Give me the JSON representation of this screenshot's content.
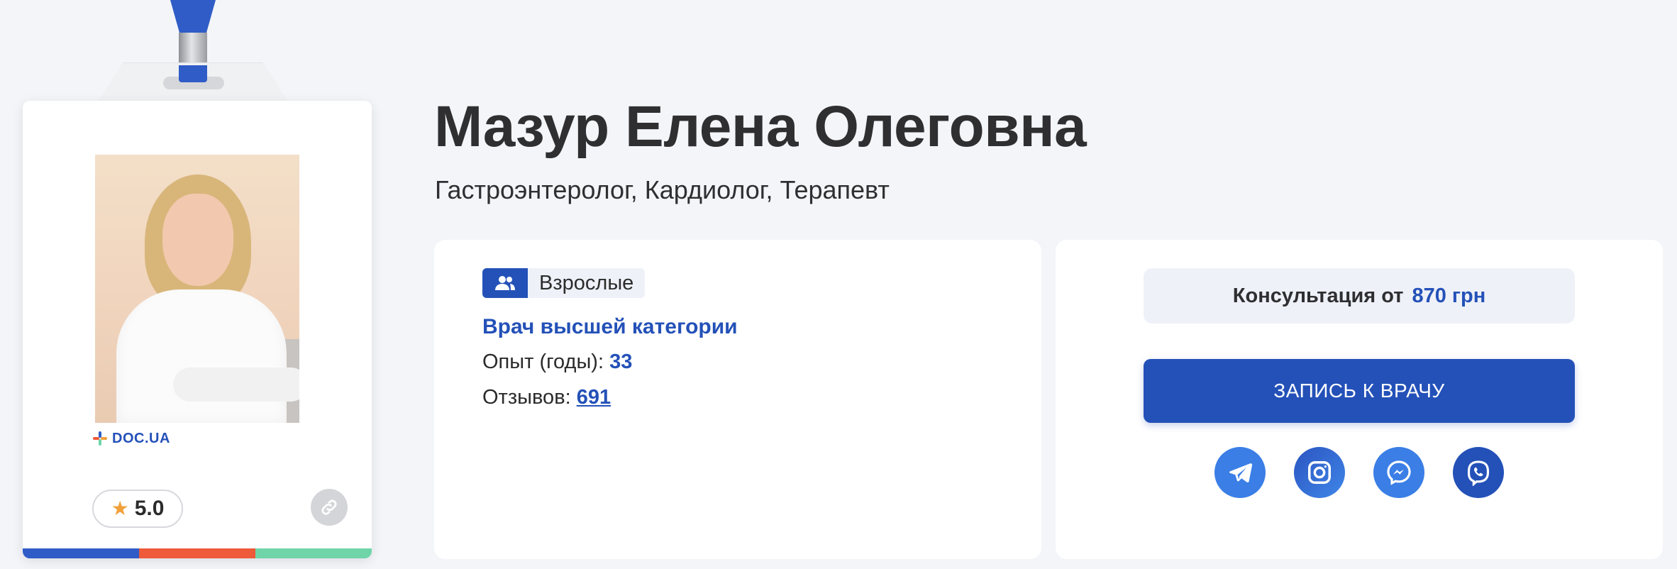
{
  "doctor": {
    "name": "Мазур Елена Олеговна",
    "specialties": "Гастроэнтеролог, Кардиолог, Терапевт"
  },
  "badge": {
    "brand": "DOC.UA",
    "rating": "5.0",
    "stripe_colors": [
      "#2f5cc7",
      "#ee5a3a",
      "#6fd5a9"
    ]
  },
  "info": {
    "age_group": "Взрослые",
    "category": "Врач высшей категории",
    "experience_label": "Опыт (годы):",
    "experience_value": "33",
    "reviews_label": "Отзывов:",
    "reviews_value": "691"
  },
  "booking": {
    "price_label": "Консультация от",
    "price_value": "870 грн",
    "book_button": "ЗАПИСЬ К ВРАЧУ",
    "socials": [
      "telegram-icon",
      "instagram-icon",
      "messenger-icon",
      "viber-icon"
    ]
  },
  "colors": {
    "accent": "#2451b8",
    "background": "#f4f5f9"
  }
}
